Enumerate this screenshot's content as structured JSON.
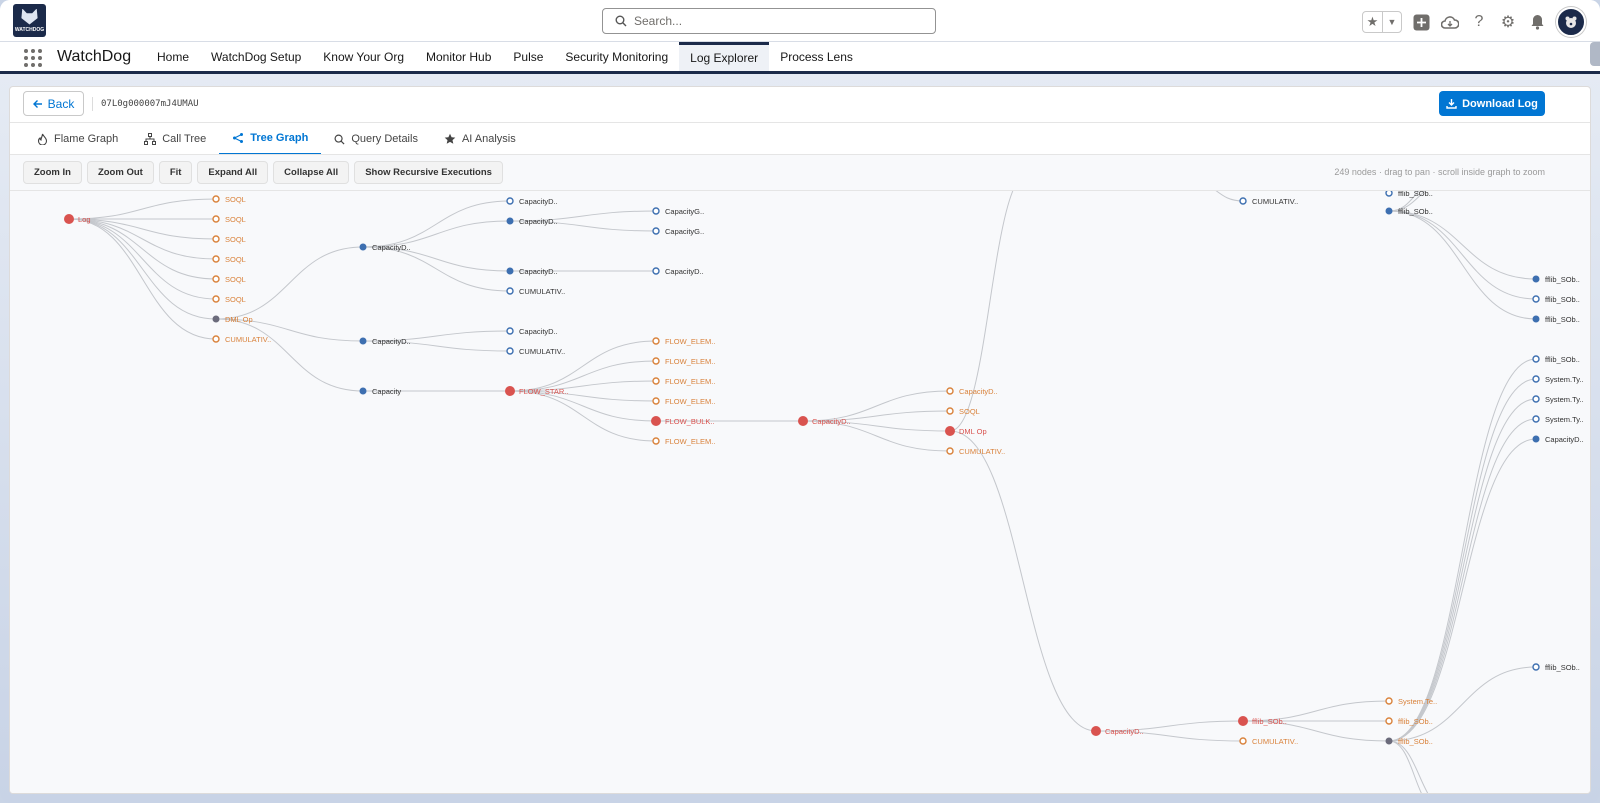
{
  "header": {
    "logo_text": "WATCHDOG",
    "search_placeholder": "Search...",
    "icons": [
      "star-icon",
      "chevron-down-icon",
      "add-icon",
      "cloud-icon",
      "help-icon",
      "gear-icon",
      "bell-icon",
      "avatar"
    ]
  },
  "nav": {
    "app_name": "WatchDog",
    "items": [
      "Home",
      "WatchDog Setup",
      "Know Your Org",
      "Monitor Hub",
      "Pulse",
      "Security Monitoring",
      "Log Explorer",
      "Process Lens"
    ],
    "active": "Log Explorer"
  },
  "card": {
    "back_label": "Back",
    "log_id": "07L0g000007mJ4UMAU",
    "download_label": "Download Log"
  },
  "tabs": [
    {
      "label": "Flame Graph",
      "icon": "flame-icon"
    },
    {
      "label": "Call Tree",
      "icon": "hierarchy-icon"
    },
    {
      "label": "Tree Graph",
      "icon": "share-icon"
    },
    {
      "label": "Query Details",
      "icon": "search-icon"
    },
    {
      "label": "AI Analysis",
      "icon": "star-icon"
    }
  ],
  "active_tab": "Tree Graph",
  "toolbar": {
    "buttons": [
      "Zoom In",
      "Zoom Out",
      "Fit",
      "Expand All",
      "Collapse All",
      "Show Recursive Executions"
    ],
    "hint": "249 nodes · drag to pan · scroll inside graph to zoom"
  },
  "colors": {
    "red": "#d9534f",
    "blue": "#3d6fb0",
    "orange": "#d9823b",
    "edge": "#c4c7cc",
    "accent": "#0176d3"
  },
  "graph": {
    "nodes": [
      {
        "id": "root",
        "label": "Log",
        "kind": "red"
      },
      {
        "id": "s1",
        "label": "SOQL",
        "kind": "orange-hollow"
      },
      {
        "id": "s2",
        "label": "SOQL",
        "kind": "orange-hollow"
      },
      {
        "id": "s3",
        "label": "SOQL",
        "kind": "orange-hollow"
      },
      {
        "id": "s4",
        "label": "SOQL",
        "kind": "orange-hollow"
      },
      {
        "id": "s5",
        "label": "SOQL",
        "kind": "orange-hollow"
      },
      {
        "id": "s6",
        "label": "SOQL",
        "kind": "orange-hollow"
      },
      {
        "id": "dml1",
        "label": "DML Op",
        "kind": "gray"
      },
      {
        "id": "cum1",
        "label": "CUMULATIV..",
        "kind": "orange-hollow"
      },
      {
        "id": "cd1",
        "label": "CapacityD..",
        "kind": "blue"
      },
      {
        "id": "cd2",
        "label": "CapacityD..",
        "kind": "blue"
      },
      {
        "id": "cap",
        "label": "Capacity",
        "kind": "blue"
      },
      {
        "id": "cd3",
        "label": "CapacityD..",
        "kind": "blue-hollow"
      },
      {
        "id": "cd4",
        "label": "CapacityD..",
        "kind": "blue"
      },
      {
        "id": "cd5",
        "label": "CapacityD..",
        "kind": "blue"
      },
      {
        "id": "cum2",
        "label": "CUMULATIV..",
        "kind": "blue-hollow"
      },
      {
        "id": "cg1",
        "label": "CapacityG..",
        "kind": "blue-hollow"
      },
      {
        "id": "cg2",
        "label": "CapacityG..",
        "kind": "blue-hollow"
      },
      {
        "id": "cd6",
        "label": "CapacityD..",
        "kind": "blue-hollow"
      },
      {
        "id": "cd7",
        "label": "CapacityD..",
        "kind": "blue-hollow"
      },
      {
        "id": "cum3",
        "label": "CUMULATIV..",
        "kind": "blue-hollow"
      },
      {
        "id": "fs",
        "label": "FLOW_STAR..",
        "kind": "red"
      },
      {
        "id": "fe1",
        "label": "FLOW_ELEM..",
        "kind": "orange-hollow"
      },
      {
        "id": "fe2",
        "label": "FLOW_ELEM..",
        "kind": "orange-hollow"
      },
      {
        "id": "fe3",
        "label": "FLOW_ELEM..",
        "kind": "orange-hollow"
      },
      {
        "id": "fe4",
        "label": "FLOW_ELEM..",
        "kind": "orange-hollow"
      },
      {
        "id": "fb",
        "label": "FLOW_BULK..",
        "kind": "red"
      },
      {
        "id": "fe5",
        "label": "FLOW_ELEM..",
        "kind": "orange-hollow"
      },
      {
        "id": "cd8",
        "label": "CapacityD..",
        "kind": "red"
      },
      {
        "id": "cd9",
        "label": "CapacityD..",
        "kind": "orange-hollow"
      },
      {
        "id": "s7",
        "label": "SOQL",
        "kind": "orange-hollow"
      },
      {
        "id": "dml2",
        "label": "DML Op",
        "kind": "red"
      },
      {
        "id": "cum4",
        "label": "CUMULATIV..",
        "kind": "orange-hollow"
      },
      {
        "id": "cd10",
        "label": "CapacityD..",
        "kind": "red"
      },
      {
        "id": "ff1",
        "label": "fflib_SOb..",
        "kind": "red"
      },
      {
        "id": "cum5",
        "label": "CUMULATIV..",
        "kind": "orange-hollow"
      },
      {
        "id": "st1",
        "label": "System.Te..",
        "kind": "orange-hollow"
      },
      {
        "id": "ff2",
        "label": "fflib_SOb..",
        "kind": "orange-hollow"
      },
      {
        "id": "ff3",
        "label": "fflib_SOb..",
        "kind": "gray"
      },
      {
        "id": "cum6",
        "label": "CUMULATIV..",
        "kind": "blue-hollow"
      },
      {
        "id": "ff4",
        "label": "fflib_SOb..",
        "kind": "blue"
      },
      {
        "id": "ff5",
        "label": "fflib_SOb..",
        "kind": "blue"
      },
      {
        "id": "ff6",
        "label": "fflib_SOb..",
        "kind": "blue-hollow"
      },
      {
        "id": "ff7",
        "label": "fflib_SOb..",
        "kind": "blue"
      },
      {
        "id": "ff8",
        "label": "fflib_SOb..",
        "kind": "blue-hollow"
      },
      {
        "id": "sys1",
        "label": "System.Ty..",
        "kind": "blue-hollow"
      },
      {
        "id": "sys2",
        "label": "System.Ty..",
        "kind": "blue-hollow"
      },
      {
        "id": "sys3",
        "label": "System.Ty..",
        "kind": "blue-hollow"
      },
      {
        "id": "cd11",
        "label": "CapacityD..",
        "kind": "blue"
      },
      {
        "id": "ff9",
        "label": "fflib_SOb..",
        "kind": "blue-hollow"
      },
      {
        "id": "ff10",
        "label": "fflib_SOb..",
        "kind": "blue-hollow"
      }
    ],
    "edges": [
      [
        "root",
        "s1"
      ],
      [
        "root",
        "s2"
      ],
      [
        "root",
        "s3"
      ],
      [
        "root",
        "s4"
      ],
      [
        "root",
        "s5"
      ],
      [
        "root",
        "s6"
      ],
      [
        "root",
        "dml1"
      ],
      [
        "root",
        "cum1"
      ],
      [
        "dml1",
        "cd1"
      ],
      [
        "dml1",
        "cd2"
      ],
      [
        "dml1",
        "cap"
      ],
      [
        "cd1",
        "cd3"
      ],
      [
        "cd1",
        "cd4"
      ],
      [
        "cd1",
        "cd5"
      ],
      [
        "cd1",
        "cum2"
      ],
      [
        "cd4",
        "cg1"
      ],
      [
        "cd4",
        "cg2"
      ],
      [
        "cd5",
        "cd6"
      ],
      [
        "cd2",
        "cd7"
      ],
      [
        "cd2",
        "cum3"
      ],
      [
        "cap",
        "fs"
      ],
      [
        "fs",
        "fe1"
      ],
      [
        "fs",
        "fe2"
      ],
      [
        "fs",
        "fe3"
      ],
      [
        "fs",
        "fe4"
      ],
      [
        "fs",
        "fb"
      ],
      [
        "fs",
        "fe5"
      ],
      [
        "fb",
        "cd8"
      ],
      [
        "cd8",
        "cd9"
      ],
      [
        "cd8",
        "s7"
      ],
      [
        "cd8",
        "dml2"
      ],
      [
        "cd8",
        "cum4"
      ],
      [
        "dml2",
        "cd10"
      ],
      [
        "cd10",
        "ff1"
      ],
      [
        "cd10",
        "cum5"
      ],
      [
        "ff1",
        "st1"
      ],
      [
        "ff1",
        "ff2"
      ],
      [
        "ff1",
        "ff3"
      ],
      [
        "ff5",
        "ff4"
      ],
      [
        "ff5",
        "ff6"
      ],
      [
        "ff5",
        "ff7"
      ],
      [
        "ff3",
        "ff8"
      ],
      [
        "ff3",
        "sys1"
      ],
      [
        "ff3",
        "sys2"
      ],
      [
        "ff3",
        "sys3"
      ],
      [
        "ff3",
        "cd11"
      ],
      [
        "ff3",
        "ff9"
      ]
    ]
  }
}
